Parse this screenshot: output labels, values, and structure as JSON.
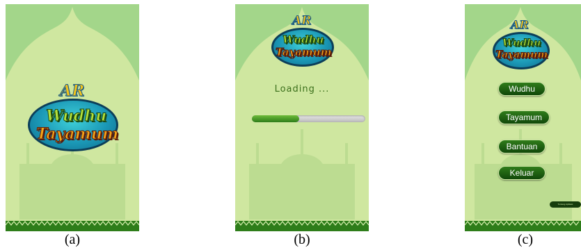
{
  "panels": [
    {
      "caption": "(a)",
      "logo": {
        "ar": "AR",
        "line1": "Wudhu",
        "line2": "Tayamum"
      }
    },
    {
      "caption": "(b)",
      "logo": {
        "ar": "AR",
        "line1": "Wudhu",
        "line2": "Tayamum"
      },
      "loading_label": "Loading ...",
      "progress": 0.42
    },
    {
      "caption": "(c)",
      "logo": {
        "ar": "AR",
        "line1": "Wudhu",
        "line2": "Tayamum"
      },
      "menu": [
        "Wudhu",
        "Tayamum",
        "Bantuan",
        "Keluar"
      ],
      "corner_button": "Tentang Aplikasi"
    }
  ],
  "colors": {
    "background_light": "#cfe7a0",
    "arch_green": "#a3d68a",
    "mosque_silhouette": "#b7d98d",
    "border_pattern": "#2e7d1a",
    "button_green": "#1f5e12"
  }
}
